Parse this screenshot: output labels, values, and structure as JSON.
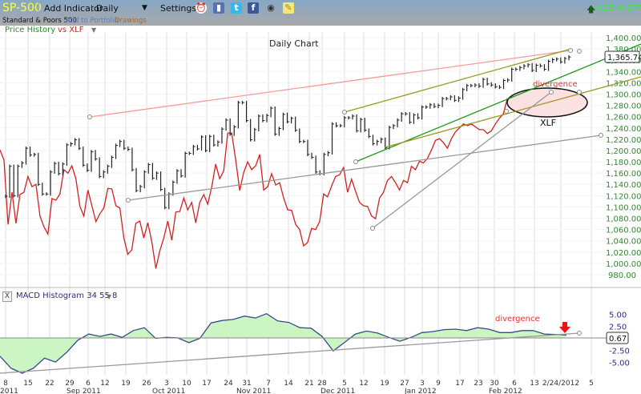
{
  "header": {
    "symbol": "SP-500",
    "add_indicator": "Add Indicator",
    "period": "Daily",
    "settings": "Settings",
    "icons": [
      "alarm-clock-icon",
      "book-icon",
      "twitter-icon",
      "facebook-icon",
      "camera-icon",
      "sticky-note-icon"
    ],
    "change": "2.28 (0.17%)",
    "change_color": "#33ee33",
    "name": "Standard & Poors 500",
    "add_to_portfolio": "Add to Portfolio",
    "drawings": "Drawings"
  },
  "legend": {
    "series": "Price History",
    "vs": "vs XLF"
  },
  "macd_header": {
    "close": "X",
    "title": "MACD Histogram 34 55 8"
  },
  "chart_data": [
    {
      "type": "ohlc-bar",
      "title": "Daily Chart",
      "ylim": [
        980,
        1400
      ],
      "yticks": [
        "1,400.00",
        "1,380.00",
        "1,360.00",
        "1,340.00",
        "1,320.00",
        "1,300.00",
        "1,280.00",
        "1,260.00",
        "1,240.00",
        "1,220.00",
        "1,200.00",
        "1,180.00",
        "1,160.00",
        "1,140.00",
        "1,120.00",
        "1,100.00",
        "1,080.00",
        "1,060.00",
        "1,040.00",
        "1,020.00",
        "1,000.00",
        "980.00"
      ],
      "last_value": "1,365.74",
      "grid": true,
      "series": [
        {
          "name": "Price History",
          "color": "#222222",
          "values": [
            1119,
            1172,
            1120,
            1172,
            1178,
            1204,
            1192,
            1193,
            1140,
            1123,
            1123,
            1162,
            1177,
            1159,
            1176,
            1210,
            1212,
            1219,
            1204,
            1174,
            1165,
            1198,
            1185,
            1154,
            1162,
            1172,
            1188,
            1209,
            1216,
            1204,
            1202,
            1166,
            1129,
            1136,
            1162,
            1175,
            1151,
            1160,
            1131,
            1099,
            1123,
            1144,
            1164,
            1155,
            1195,
            1195,
            1207,
            1203,
            1224,
            1200,
            1225,
            1210,
            1215,
            1238,
            1254,
            1229,
            1242,
            1285,
            1285,
            1253,
            1219,
            1237,
            1261,
            1253,
            1262,
            1275,
            1229,
            1239,
            1264,
            1251,
            1257,
            1236,
            1216,
            1216,
            1193,
            1188,
            1162,
            1159,
            1193,
            1196,
            1247,
            1244,
            1244,
            1258,
            1258,
            1261,
            1235,
            1255,
            1236,
            1225,
            1212,
            1216,
            1220,
            1205,
            1241,
            1244,
            1254,
            1265,
            1265,
            1250,
            1263,
            1258,
            1277,
            1277,
            1281,
            1278,
            1280,
            1292,
            1292,
            1295,
            1289,
            1293,
            1308,
            1315,
            1315,
            1316,
            1314,
            1326,
            1318,
            1316,
            1313,
            1312,
            1324,
            1325,
            1344,
            1344,
            1347,
            1350,
            1352,
            1342,
            1351,
            1350,
            1344,
            1358,
            1361,
            1362,
            1357,
            1363,
            1365.74
          ]
        },
        {
          "name": "XLF",
          "color": "#d42020",
          "values": [
            1201,
            1183,
            1069,
            1126,
            1071,
            1122,
            1126,
            1154,
            1136,
            1140,
            1084,
            1065,
            1052,
            1115,
            1112,
            1123,
            1166,
            1160,
            1173,
            1150,
            1101,
            1084,
            1130,
            1102,
            1074,
            1088,
            1098,
            1133,
            1132,
            1102,
            1098,
            1045,
            1016,
            1024,
            1071,
            1075,
            1045,
            1072,
            1038,
            991,
            1022,
            1045,
            1075,
            1041,
            1091,
            1092,
            1116,
            1095,
            1108,
            1072,
            1108,
            1122,
            1105,
            1136,
            1176,
            1150,
            1164,
            1231,
            1231,
            1183,
            1129,
            1161,
            1180,
            1166,
            1173,
            1193,
            1130,
            1136,
            1159,
            1139,
            1143,
            1116,
            1095,
            1094,
            1069,
            1060,
            1031,
            1037,
            1062,
            1060,
            1074,
            1123,
            1118,
            1137,
            1154,
            1157,
            1170,
            1126,
            1149,
            1128,
            1108,
            1102,
            1101,
            1084,
            1079,
            1116,
            1126,
            1147,
            1154,
            1143,
            1130,
            1147,
            1143,
            1172,
            1166,
            1181,
            1178,
            1186,
            1201,
            1218,
            1221,
            1214,
            1204,
            1221,
            1233,
            1240,
            1247,
            1244,
            1247,
            1242,
            1237,
            1237,
            1230,
            1235,
            1247,
            1257,
            1265,
            1292,
            1289,
            1286,
            1296,
            1286,
            1281,
            1292,
            1296,
            1282,
            1271,
            1292,
            1296,
            1286,
            1278,
            1289,
            1286
          ]
        }
      ],
      "annotations": [
        {
          "text": "divergence",
          "color": "#ee3030"
        },
        {
          "text": "XLF",
          "color": "#111111"
        }
      ]
    },
    {
      "type": "area",
      "title": "MACD Histogram 34 55 8",
      "ylim": [
        -7.5,
        7.5
      ],
      "yticks": [
        "5.00",
        "2.50",
        "-2.50",
        "-5.00"
      ],
      "last_value": "0.67",
      "fill": "#ccf5c4",
      "line": "#3a4a8a",
      "values": [
        -3.7,
        -6.2,
        -7.2,
        -6.2,
        -4.1,
        -4.9,
        -2.9,
        -0.4,
        0.9,
        0.4,
        0.9,
        0.2,
        1.6,
        2.2,
        0,
        0.2,
        0.1,
        -0.9,
        0,
        3.2,
        3.7,
        3.9,
        4.6,
        4.2,
        5.1,
        3.6,
        3.3,
        2.2,
        2.1,
        0.4,
        -2.6,
        -0.9,
        0.9,
        1.5,
        1.1,
        0.2,
        -0.6,
        0.2,
        1.2,
        1.4,
        1.8,
        1.9,
        1.6,
        2.2,
        1.9,
        1.2,
        1.2,
        1.6,
        1.6,
        0.9,
        0.8,
        0.7
      ],
      "annotations": [
        {
          "text": "divergence",
          "color": "#ee3030"
        }
      ]
    }
  ],
  "x_axis": {
    "day_ticks": [
      "8",
      "15",
      "22",
      "29",
      "6",
      "12",
      "19",
      "26",
      "3",
      "10",
      "17",
      "24",
      "31",
      "7",
      "14",
      "21",
      "28",
      "5",
      "12",
      "19",
      "27",
      "3",
      "9",
      "17",
      "23",
      "30",
      "6",
      "13",
      "2/24/2012",
      "5"
    ],
    "month_ticks": [
      "2011",
      "Sep 2011",
      "Oct 2011",
      "Nov 2011",
      "Dec 2011",
      "Jan 2012",
      "Feb 2012"
    ]
  }
}
